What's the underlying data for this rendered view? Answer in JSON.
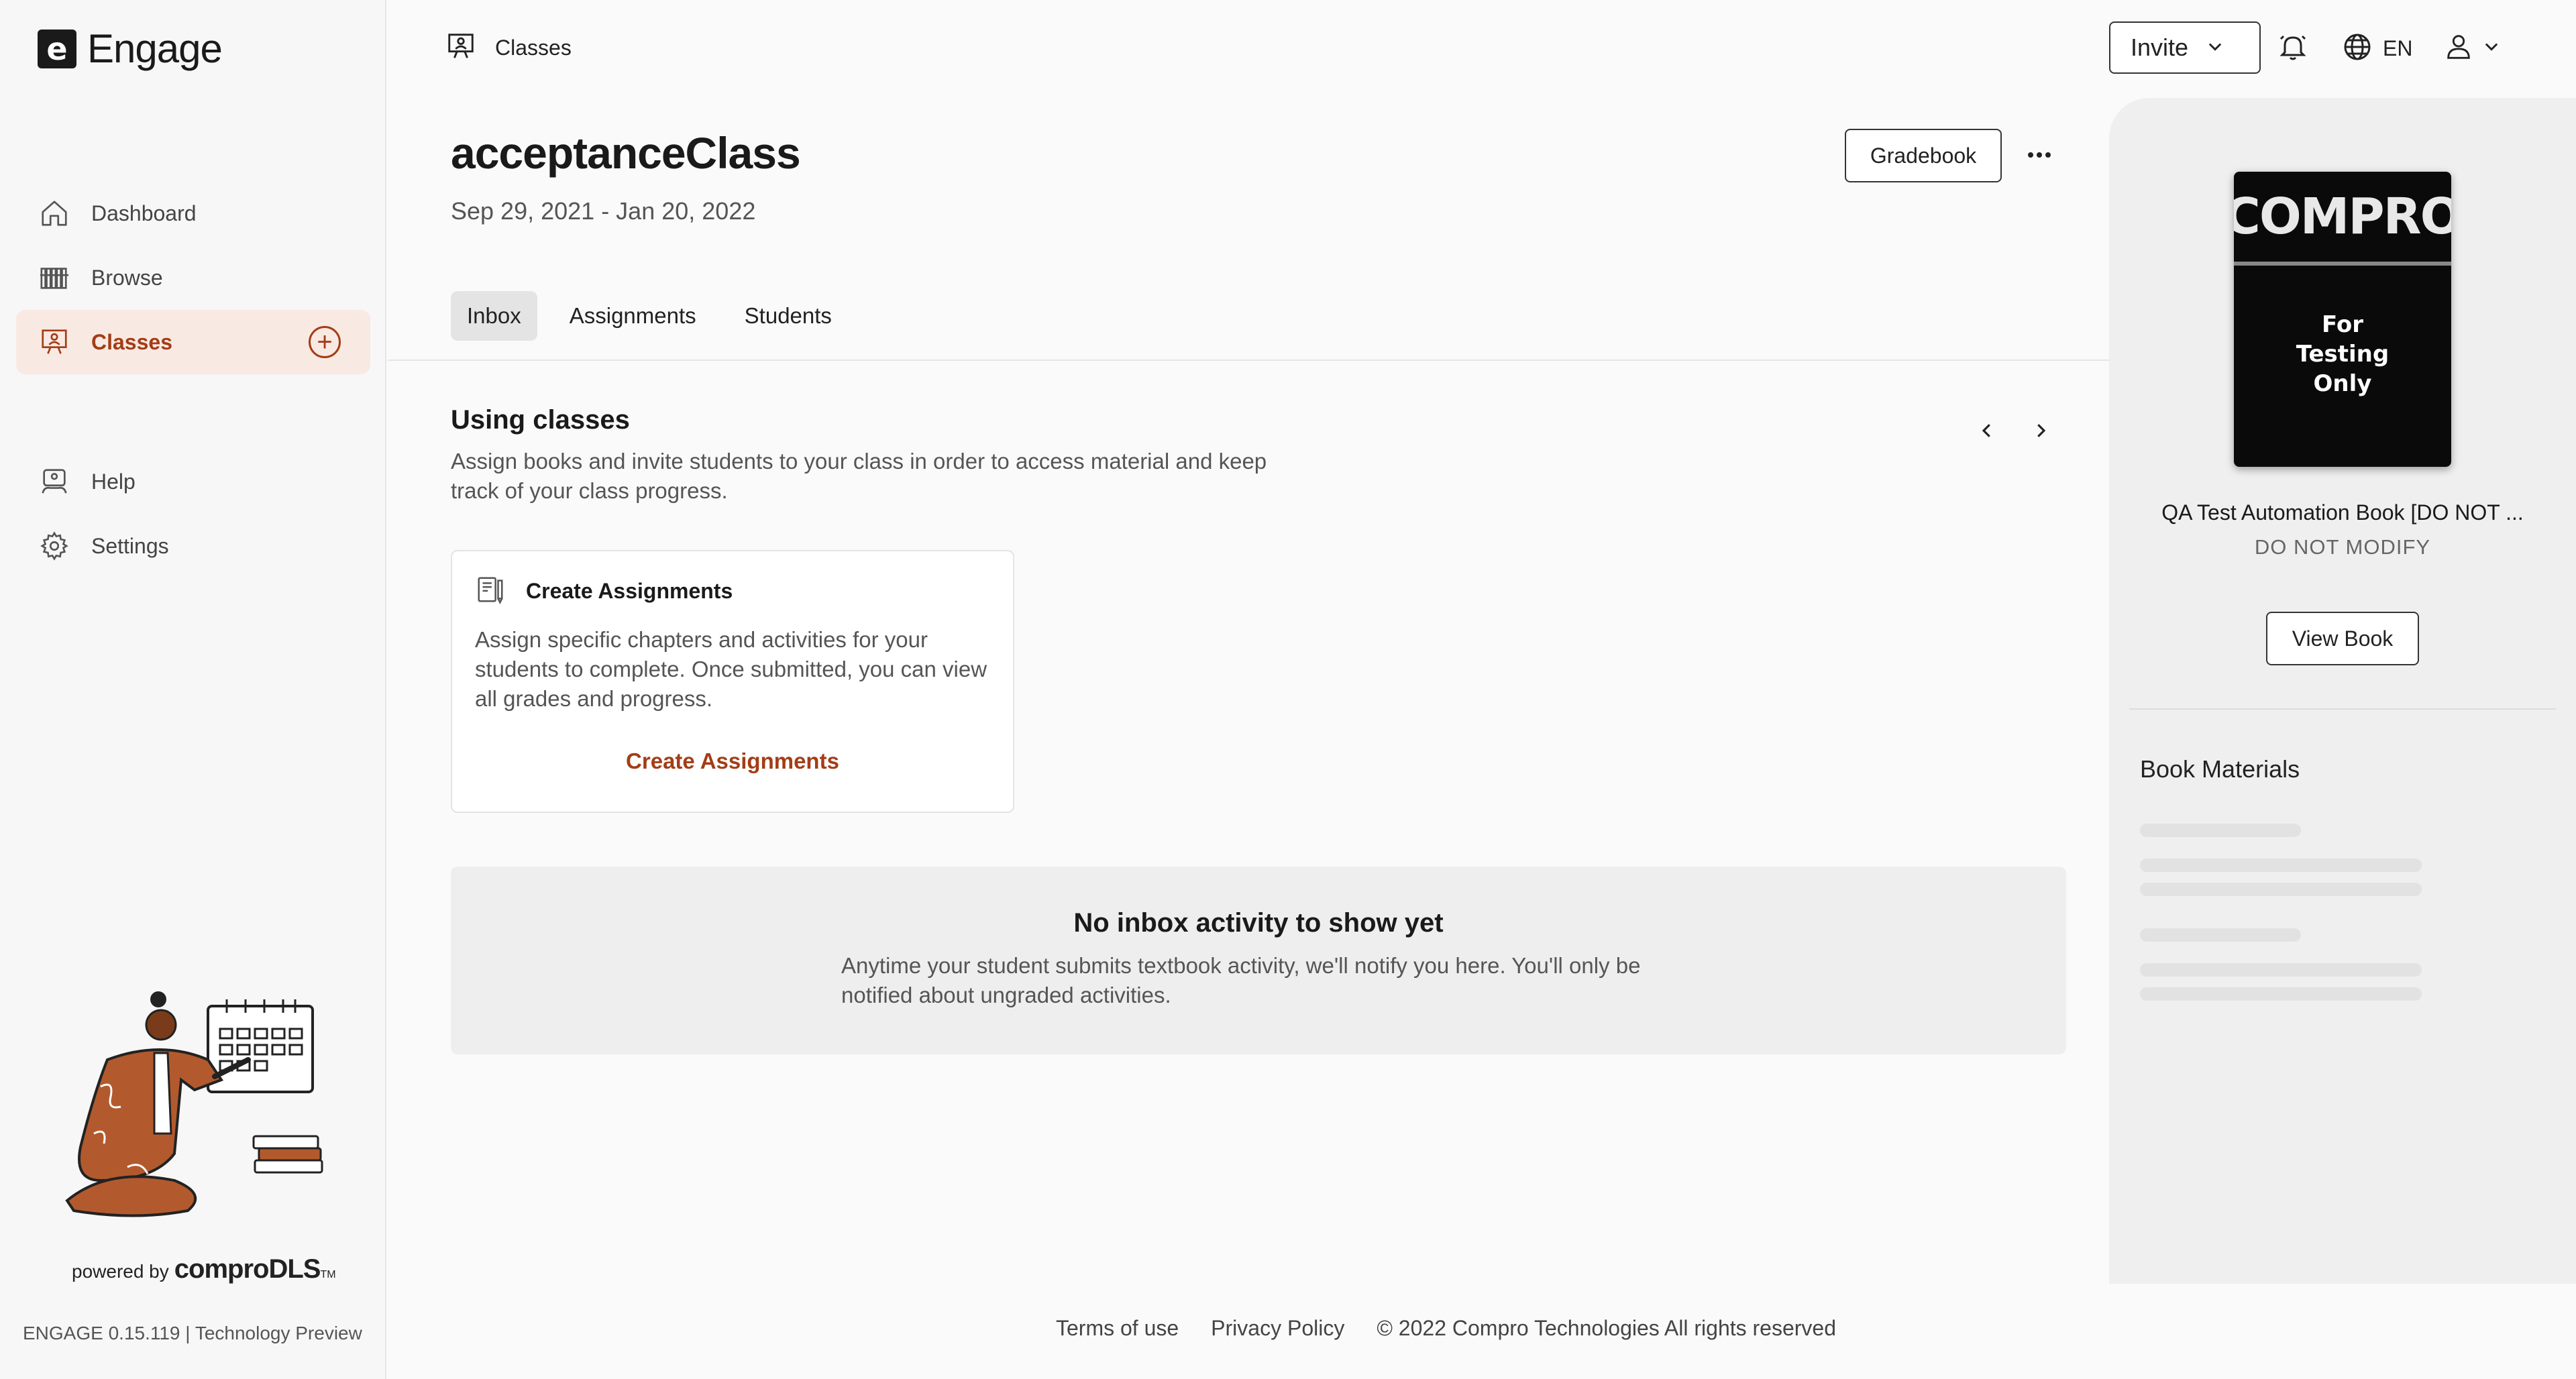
{
  "app": {
    "name": "Engage",
    "logo_letter": "e"
  },
  "sidebar": {
    "items": [
      {
        "label": "Dashboard",
        "icon": "home-icon"
      },
      {
        "label": "Browse",
        "icon": "bookshelf-icon"
      },
      {
        "label": "Classes",
        "icon": "classroom-icon",
        "active": true
      },
      {
        "label": "Help",
        "icon": "help-icon"
      },
      {
        "label": "Settings",
        "icon": "gear-icon"
      }
    ],
    "powered_by": "powered by",
    "powered_brand": "comproDLS",
    "trademark": "TM",
    "version": "ENGAGE 0.15.119 | Technology Preview"
  },
  "header": {
    "breadcrumb": "Classes",
    "invite_label": "Invite",
    "language": "EN"
  },
  "class": {
    "title": "acceptanceClass",
    "dates": "Sep 29, 2021 - Jan 20, 2022",
    "gradebook_label": "Gradebook"
  },
  "tabs": [
    {
      "label": "Inbox",
      "active": true
    },
    {
      "label": "Assignments"
    },
    {
      "label": "Students"
    }
  ],
  "using_classes": {
    "title": "Using classes",
    "description": "Assign books and invite students to your class in order to access material and keep track of your class progress."
  },
  "card": {
    "title": "Create Assignments",
    "body": "Assign specific chapters and activities for your students to complete. Once submitted, you can view all grades and progress.",
    "link": "Create Assignments"
  },
  "inbox_empty": {
    "title": "No inbox activity to show yet",
    "description": "Anytime your student submits textbook activity, we'll notify you here. You'll only be notified about ungraded activities."
  },
  "footer": {
    "terms": "Terms of use",
    "privacy": "Privacy Policy",
    "copyright": "© 2022 Compro Technologies All rights reserved"
  },
  "book_panel": {
    "cover_title": "COMPRO",
    "cover_subtitle_line1": "For",
    "cover_subtitle_line2": "Testing",
    "cover_subtitle_line3": "Only",
    "book_title": "QA Test Automation Book [DO NOT ...",
    "book_subtitle": "DO NOT MODIFY",
    "view_book_label": "View Book",
    "materials_title": "Book Materials"
  },
  "colors": {
    "accent": "#a33d16",
    "active_bg": "#f9e9e3",
    "panel_bg": "#efefef"
  }
}
